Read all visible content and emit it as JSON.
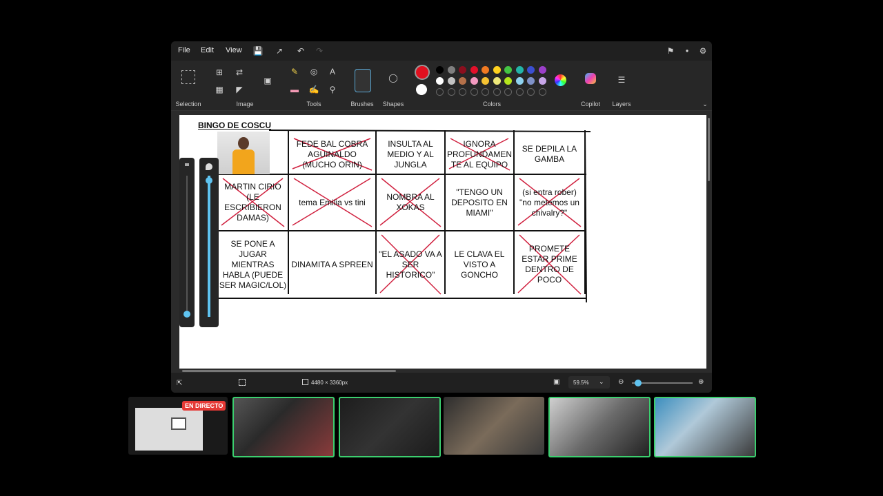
{
  "menu": {
    "file": "File",
    "edit": "Edit",
    "view": "View"
  },
  "ribbon": {
    "groups": {
      "selection": "Selection",
      "image": "Image",
      "tools": "Tools",
      "brushes": "Brushes",
      "shapes": "Shapes",
      "colors": "Colors",
      "copilot": "Copilot",
      "layers": "Layers"
    },
    "tool_glyphs": {
      "text": "A"
    },
    "primary_color": "#e0101f",
    "secondary_color": "#ffffff",
    "palette_row1": [
      "#000000",
      "#7f7f7f",
      "#8b0f1e",
      "#e3102a",
      "#f07a22",
      "#ffd21f",
      "#44c544",
      "#23b5a8",
      "#3b4fd1",
      "#9b3fc9"
    ],
    "palette_row2": [
      "#ffffff",
      "#c3c3c3",
      "#b5714a",
      "#f39ac0",
      "#f5c232",
      "#efe97a",
      "#b5e61d",
      "#8fd3f0",
      "#7f92c8",
      "#c7a6e8"
    ]
  },
  "canvas": {
    "title": "BINGO DE COSCU",
    "cells": [
      "",
      "FEDE BAL COBRA AGUINALDO (MUCHO ORIN)",
      "INSULTA AL MEDIO Y AL JUNGLA",
      "IGNORA PROFUNDAMEN TE AL EQUIPO",
      "SE DEPILA LA GAMBA",
      "MARTIN CIRIO (LE ESCRIBIERON DAMAS)",
      "tema Emilia vs tini",
      "NOMBRA AL XOKAS",
      "\"TENGO UN DEPOSITO EN MIAMI\"",
      "(si entra rober) \"no metemos un chivalry?\"",
      "SE PONE A JUGAR MIENTRAS HABLA (PUEDE SER MAGIC/LOL)",
      "DINAMITA A SPREEN",
      "\"EL ASADO VA A SER HISTORICO\"",
      "LE CLAVA EL VISTO A GONCHO",
      "PROMETE ESTAR PRIME DENTRO DE POCO"
    ],
    "crossed": [
      1,
      3,
      5,
      6,
      7,
      9,
      12,
      14
    ]
  },
  "status": {
    "image_size": "4480 × 3360px",
    "zoom": "59.5%",
    "zoom_level": 0.05
  },
  "stream": {
    "live_badge": "EN DIRECTO"
  }
}
